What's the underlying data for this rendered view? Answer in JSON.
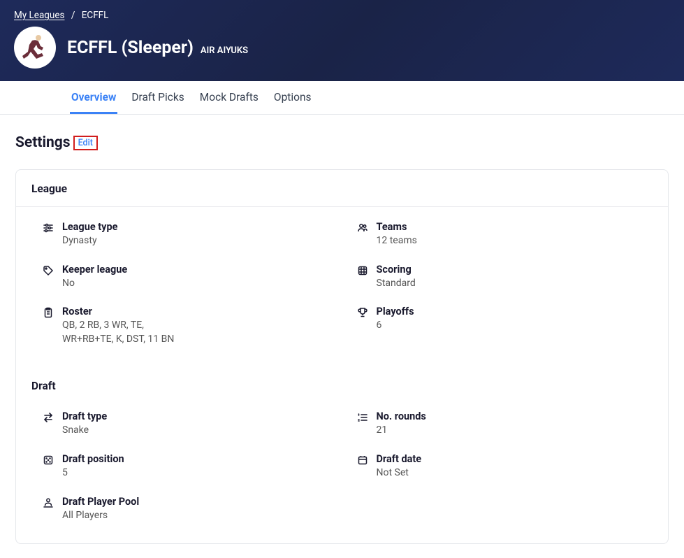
{
  "breadcrumb": {
    "parent": "My Leagues",
    "current": "ECFFL"
  },
  "league": {
    "title": "ECFFL (Sleeper)",
    "subtitle": "AIR AIYUKS"
  },
  "tabs": {
    "overview": "Overview",
    "draft_picks": "Draft Picks",
    "mock_drafts": "Mock Drafts",
    "options": "Options"
  },
  "settings": {
    "title": "Settings",
    "edit": "Edit"
  },
  "sections": {
    "league": {
      "title": "League",
      "league_type": {
        "label": "League type",
        "value": "Dynasty"
      },
      "teams": {
        "label": "Teams",
        "value": "12 teams"
      },
      "keeper": {
        "label": "Keeper league",
        "value": "No"
      },
      "scoring": {
        "label": "Scoring",
        "value": "Standard"
      },
      "roster": {
        "label": "Roster",
        "value": "QB, 2 RB, 3 WR, TE, WR+RB+TE, K, DST, 11 BN"
      },
      "playoffs": {
        "label": "Playoffs",
        "value": "6"
      }
    },
    "draft": {
      "title": "Draft",
      "draft_type": {
        "label": "Draft type",
        "value": "Snake"
      },
      "no_rounds": {
        "label": "No. rounds",
        "value": "21"
      },
      "draft_position": {
        "label": "Draft position",
        "value": "5"
      },
      "draft_date": {
        "label": "Draft date",
        "value": "Not Set"
      },
      "player_pool": {
        "label": "Draft Player Pool",
        "value": "All Players"
      }
    }
  }
}
